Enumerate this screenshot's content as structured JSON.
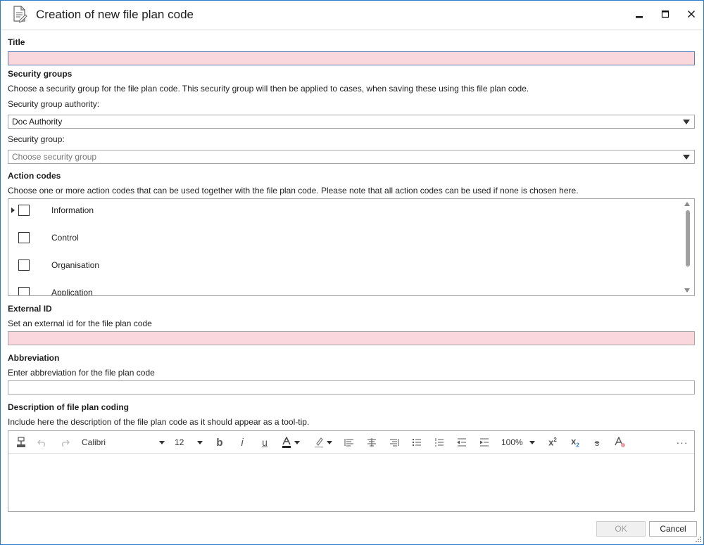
{
  "window": {
    "title": "Creation of new file plan code",
    "icon": "document-edit-icon"
  },
  "title_section": {
    "label": "Title",
    "value": ""
  },
  "security": {
    "heading": "Security groups",
    "description": "Choose a security group for the file plan code. This security group will then be applied to cases, when saving these using this file plan code.",
    "authority_label": "Security group authority:",
    "authority_value": "Doc Authority",
    "group_label": "Security group:",
    "group_placeholder": "Choose security group"
  },
  "action_codes": {
    "heading": "Action codes",
    "description": "Choose one or more action codes that can be used together with the file plan code. Please note that all action codes can be used if none is chosen here.",
    "items": [
      {
        "label": "Information",
        "checked": false,
        "expandable": true
      },
      {
        "label": "Control",
        "checked": false,
        "expandable": false
      },
      {
        "label": "Organisation",
        "checked": false,
        "expandable": false
      },
      {
        "label": "Application",
        "checked": false,
        "expandable": false
      }
    ]
  },
  "external_id": {
    "heading": "External ID",
    "description": "Set an external id for the file plan code",
    "value": ""
  },
  "abbreviation": {
    "heading": "Abbreviation",
    "description": "Enter abbreviation for the file plan code",
    "value": ""
  },
  "description_section": {
    "heading": "Description of file plan coding",
    "description": "Include here the description of the file plan code as it should appear as a tool-tip.",
    "toolbar": {
      "font": "Calibri",
      "size": "12",
      "zoom": "100%",
      "more": "···"
    }
  },
  "buttons": {
    "ok": "OK",
    "cancel": "Cancel"
  },
  "colors": {
    "required_bg": "#f9d7dc",
    "window_border": "#2b79c9"
  }
}
